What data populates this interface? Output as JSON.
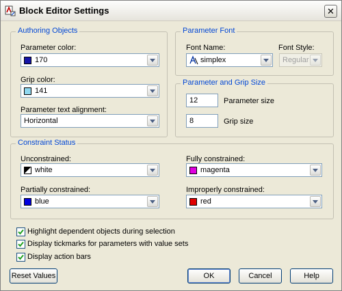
{
  "window": {
    "title": "Block Editor Settings"
  },
  "authoring": {
    "legend": "Authoring Objects",
    "param_color": {
      "label": "Parameter color:",
      "value": "170",
      "swatch": "#1414a8"
    },
    "grip_color": {
      "label": "Grip color:",
      "value": "141",
      "swatch": "#8fd8f0"
    },
    "text_align": {
      "label": "Parameter text alignment:",
      "value": "Horizontal"
    }
  },
  "param_font": {
    "legend": "Parameter Font",
    "font_name_label": "Font Name:",
    "font_name_value": "simplex",
    "font_style_label": "Font Style:",
    "font_style_value": "Regular"
  },
  "size": {
    "legend": "Parameter and Grip Size",
    "param_size_value": "12",
    "param_size_label": "Parameter size",
    "grip_size_value": "8",
    "grip_size_label": "Grip size"
  },
  "constraint": {
    "legend": "Constraint Status",
    "unconstrained": {
      "label": "Unconstrained:",
      "value": "white"
    },
    "fully": {
      "label": "Fully constrained:",
      "value": "magenta",
      "swatch": "#e000e0"
    },
    "partially": {
      "label": "Partially constrained:",
      "value": "blue",
      "swatch": "#0000e0"
    },
    "improperly": {
      "label": "Improperly constrained:",
      "value": "red",
      "swatch": "#e00000"
    }
  },
  "options": [
    {
      "label": "Highlight dependent objects during selection",
      "checked": true
    },
    {
      "label": "Display tickmarks for parameters with value sets",
      "checked": true
    },
    {
      "label": "Display action bars",
      "checked": true
    }
  ],
  "buttons": {
    "reset": "Reset Values",
    "ok": "OK",
    "cancel": "Cancel",
    "help": "Help"
  }
}
